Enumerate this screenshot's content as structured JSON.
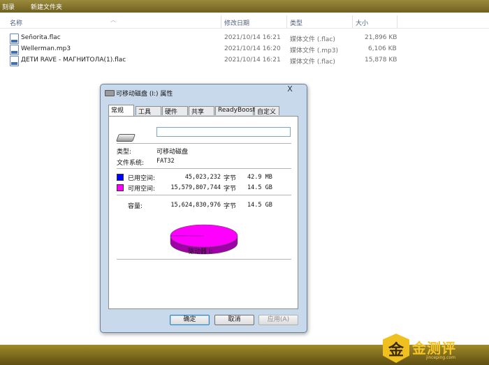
{
  "toolbar": {
    "burn": "刻录",
    "new_folder": "新建文件夹"
  },
  "columns": {
    "name": "名称",
    "modified": "修改日期",
    "type": "类型",
    "size": "大小"
  },
  "files": [
    {
      "name": "Señorita.flac",
      "modified": "2021/10/14 16:21",
      "type": "媒体文件 (.flac)",
      "size": "21,896 KB"
    },
    {
      "name": "Wellerman.mp3",
      "modified": "2021/10/14 16:20",
      "type": "媒体文件 (.mp3)",
      "size": "6,106 KB"
    },
    {
      "name": "ДЕТИ RAVE - МАГНИТОЛА(1).flac",
      "modified": "2021/10/14 16:21",
      "type": "媒体文件 (.flac)",
      "size": "15,878 KB"
    }
  ],
  "dialog": {
    "title": "可移动磁盘 (I:) 属性",
    "close_glyph": "X",
    "tabs": [
      "常规",
      "工具",
      "硬件",
      "共享",
      "ReadyBoost",
      "自定义"
    ],
    "volume_label_value": "",
    "type_label": "类型:",
    "type_value": "可移动磁盘",
    "fs_label": "文件系统:",
    "fs_value": "FAT32",
    "used": {
      "label": "已用空间:",
      "bytes": "45,023,232",
      "unit": "字节",
      "human": "42.9 MB",
      "color": "#0000ff"
    },
    "free": {
      "label": "可用空间:",
      "bytes": "15,579,807,744",
      "unit": "字节",
      "human": "14.5 GB",
      "color": "#ff00ff"
    },
    "capacity": {
      "label": "容量:",
      "bytes": "15,624,830,976",
      "unit": "字节",
      "human": "14.5 GB"
    },
    "drive_label": "驱动器 I:",
    "used_fraction": 0.0029,
    "buttons": {
      "ok": "确定",
      "cancel": "取消",
      "apply": "应用(A)"
    }
  },
  "watermark": {
    "glyph": "金",
    "brand": "金测评",
    "url": "jinceping.com"
  }
}
